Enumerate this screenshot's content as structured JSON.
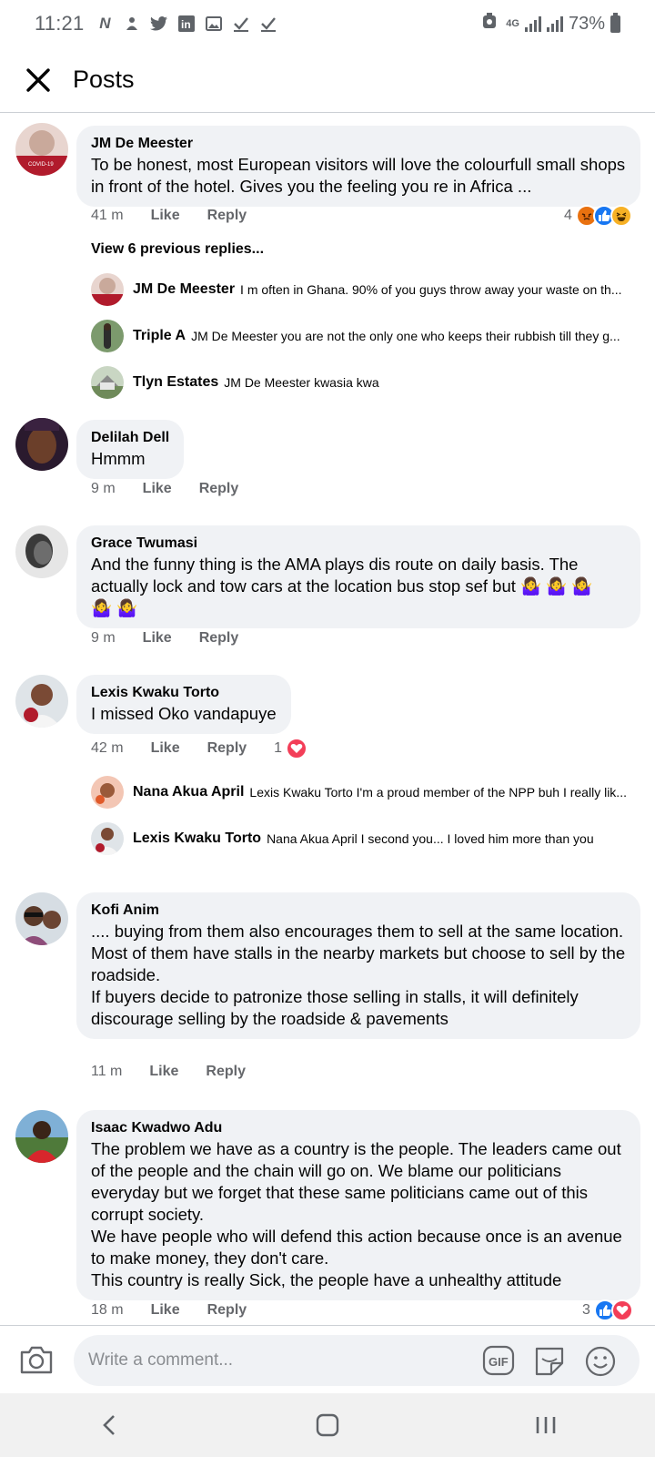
{
  "status_bar": {
    "time": "11:21",
    "notification_icons": [
      "n-logo-icon",
      "aid-icon",
      "twitter-icon",
      "linkedin-icon",
      "gallery-icon",
      "check-icon",
      "check-icon"
    ],
    "network": "4G",
    "battery": "73%"
  },
  "header": {
    "title": "Posts",
    "close_icon": "close-icon"
  },
  "comments": [
    {
      "author": "JM De Meester",
      "text": "To be honest, most European visitors will love the colourfull small shops in front of the hotel. Gives you the feeling you re in Africa ...",
      "time": "41 m",
      "like": "Like",
      "reply": "Reply",
      "reaction_count": "4",
      "reactions": [
        "angry",
        "like",
        "haha"
      ],
      "view_previous": "View 6 previous replies...",
      "replies": [
        {
          "author": "JM De Meester",
          "text": "I m often in Ghana. 90% of you guys throw away your waste on th..."
        },
        {
          "author": "Triple A",
          "text": "JM De Meester you are not the only one who keeps  their rubbish  till they g..."
        },
        {
          "author": "Tlyn Estates",
          "text": "JM De Meester kwasia kwa"
        }
      ]
    },
    {
      "author": "Delilah Dell",
      "text": "Hmmm",
      "time": "9 m",
      "like": "Like",
      "reply": "Reply"
    },
    {
      "author": "Grace Twumasi",
      "text": "And the funny thing is the AMA plays dis route on daily basis. The actually lock and tow cars at the location bus stop sef but 🤷‍♀️ 🤷‍♀️ 🤷‍♀️\n🤷‍♀️ 🤷‍♀️",
      "time": "9 m",
      "like": "Like",
      "reply": "Reply"
    },
    {
      "author": "Lexis Kwaku Torto",
      "text": "I missed Oko vandapuye",
      "time": "42 m",
      "like": "Like",
      "reply": "Reply",
      "reaction_count": "1",
      "reactions": [
        "love"
      ],
      "replies": [
        {
          "author": "Nana Akua April",
          "text": "Lexis Kwaku Torto I'm a proud member of the NPP buh I really lik..."
        },
        {
          "author": "Lexis Kwaku Torto",
          "text": "Nana Akua April I second you... I loved him more than you"
        }
      ]
    },
    {
      "author": "Kofi Anim",
      "text": ".... buying from them also encourages them to sell at the same location.\nMost of them have stalls in the nearby markets but choose to sell by the roadside.\nIf buyers decide to patronize those selling in stalls, it will definitely discourage selling  by the roadside & pavements",
      "time": "11 m",
      "like": "Like",
      "reply": "Reply"
    },
    {
      "author": "Isaac Kwadwo Adu",
      "text": "The problem we have as a country is the people. The leaders came out of the people and the chain will go on. We  blame our politicians everyday but we forget that these same politicians came out of this corrupt society.\nWe have people who will defend this action because once is an avenue to make money, they don't care.\n     This country is really Sick, the people have a unhealthy attitude",
      "time": "18 m",
      "like": "Like",
      "reply": "Reply",
      "reaction_count": "3",
      "reactions": [
        "like",
        "love"
      ]
    }
  ],
  "composer": {
    "placeholder": "Write a comment...",
    "camera_icon": "camera-icon",
    "gif_icon": "gif-icon",
    "sticker_icon": "sticker-icon",
    "emoji_icon": "emoji-icon"
  },
  "nav_bar": {
    "back_icon": "back-icon",
    "home_icon": "home-icon",
    "recents_icon": "recents-icon"
  },
  "colors": {
    "bubble": "#f0f2f5",
    "secondary_text": "#65676b",
    "like_blue": "#1877f2",
    "love_red": "#f33e58",
    "angry_orange": "#e9710f",
    "haha_yellow": "#f7b125"
  }
}
